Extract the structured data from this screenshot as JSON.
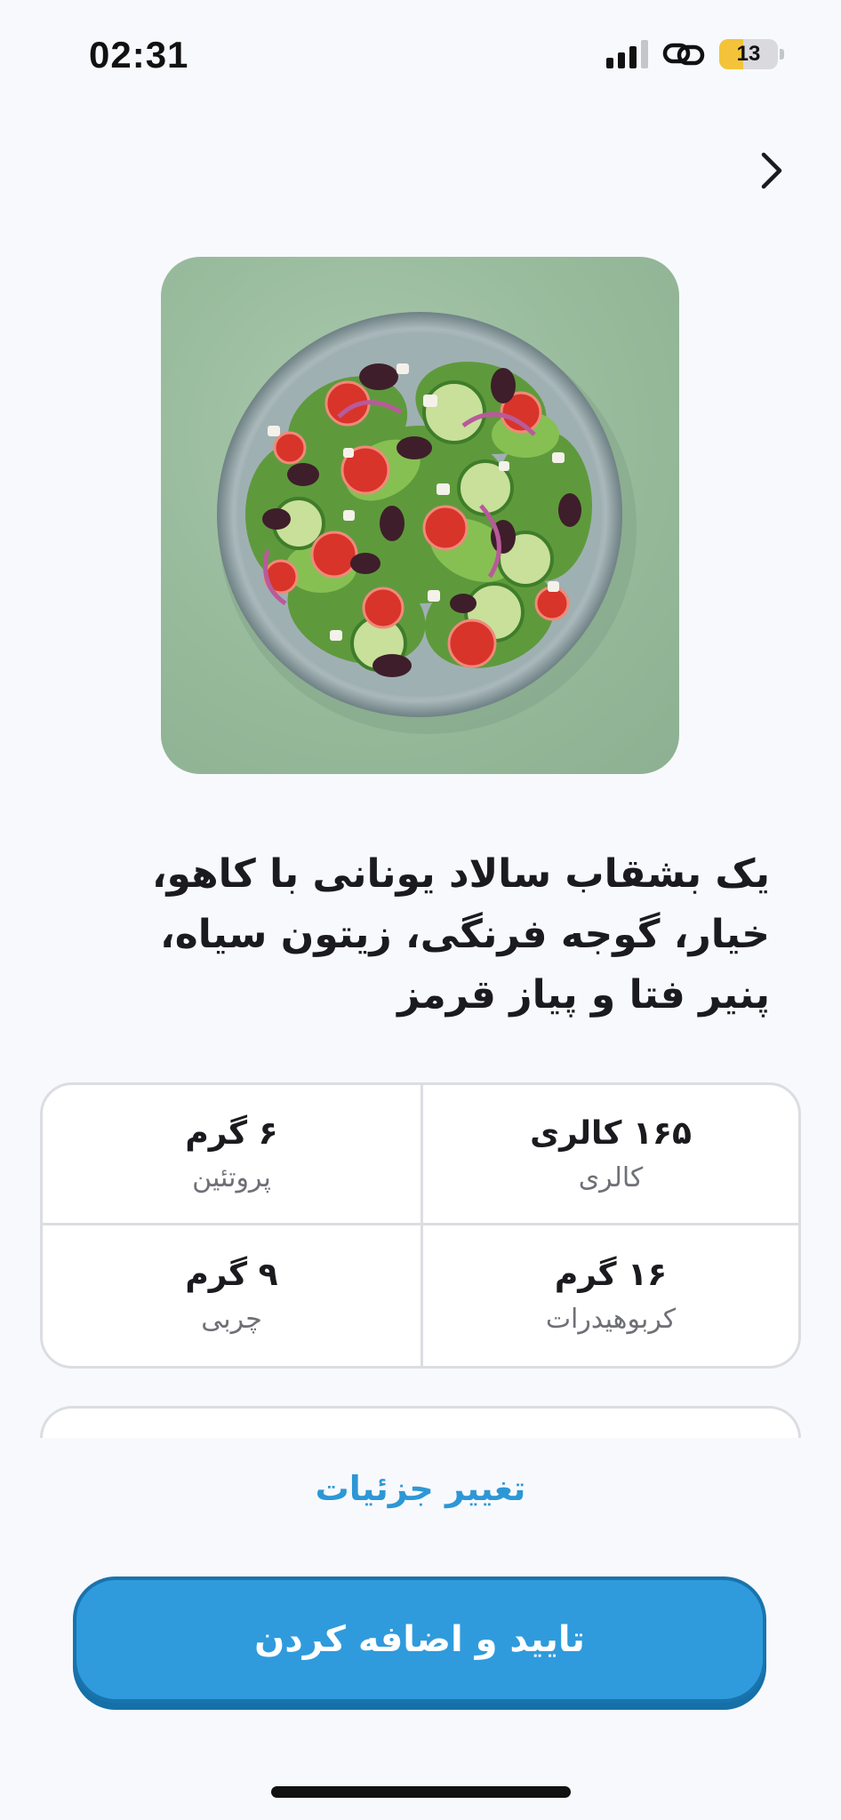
{
  "status_bar": {
    "time": "02:31",
    "battery_level": "13",
    "battery_fraction": 0.13,
    "icons": [
      "signal-icon",
      "link-icon",
      "battery-icon"
    ]
  },
  "nav": {
    "back_icon": "chevron-right-icon"
  },
  "meal": {
    "image": "greek-salad-photo",
    "title": "یک بشقاب سالاد یونانی با کاهو، خیار، گوجه فرنگی، زیتون سیاه، پنیر فتا و پیاز قرمز"
  },
  "nutrition": {
    "calories": {
      "value": "۱۶۵ کالری",
      "label": "کالری"
    },
    "protein": {
      "value": "۶ گرم",
      "label": "پروتئین"
    },
    "carbs": {
      "value": "۱۶ گرم",
      "label": "کربوهیدرات"
    },
    "fat": {
      "value": "۹ گرم",
      "label": "چربی"
    }
  },
  "actions": {
    "edit_label": "تغییر جزئیات",
    "confirm_label": "تایید و اضافه کردن"
  },
  "colors": {
    "accent": "#2f9bdc",
    "accent_dark": "#1973ad",
    "link": "#2d97d6",
    "battery_fill": "#f4c33a",
    "background": "#f8f9fc"
  }
}
